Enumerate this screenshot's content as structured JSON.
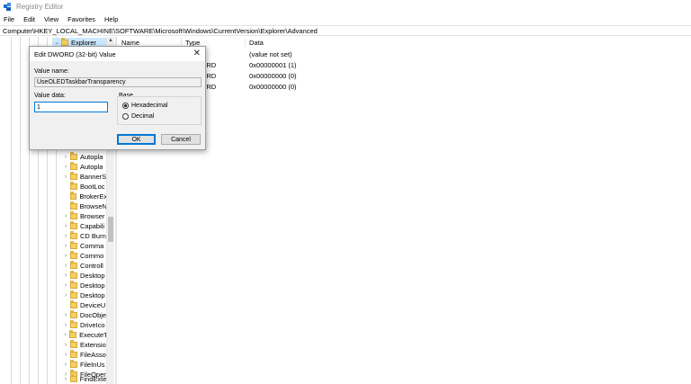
{
  "window": {
    "title": "Registry Editor"
  },
  "menu": [
    "File",
    "Edit",
    "View",
    "Favorites",
    "Help"
  ],
  "address": "Computer\\HKEY_LOCAL_MACHINE\\SOFTWARE\\Microsoft\\Windows\\CurrentVersion\\Explorer\\Advanced",
  "tree": {
    "selected": "Explorer",
    "items": [
      "Autopla",
      "Autopla",
      "BannerS",
      "BootLoc",
      "BrokerEx",
      "BrowseN",
      "Browser",
      "Capabili",
      "CD Burn",
      "Comma",
      "Commo",
      "Controll",
      "Desktop",
      "Desktop",
      "Desktop",
      "DeviceU",
      "DocObje",
      "DriveIco",
      "ExecuteT",
      "Extensio",
      "FileAsso",
      "FileInUs",
      "FileOper",
      "FindExte"
    ]
  },
  "list": {
    "columns": [
      "Name",
      "Type",
      "Data"
    ],
    "rows": [
      {
        "type": "",
        "data": "(value not set)"
      },
      {
        "type": "DWORD",
        "data": "0x00000001 (1)"
      },
      {
        "type": "DWORD",
        "data": "0x00000000 (0)"
      },
      {
        "type": "DWORD",
        "data": "0x00000000 (0)"
      }
    ]
  },
  "dialog": {
    "title": "Edit DWORD (32-bit) Value",
    "value_name_label": "Value name:",
    "value_name": "UseOLEDTaskbarTransparency",
    "value_data_label": "Value data:",
    "value_data": "1",
    "base_label": "Base",
    "hex_label": "Hexadecimal",
    "dec_label": "Decimal",
    "ok_label": "OK",
    "cancel_label": "Cancel",
    "close_glyph": "✕"
  }
}
